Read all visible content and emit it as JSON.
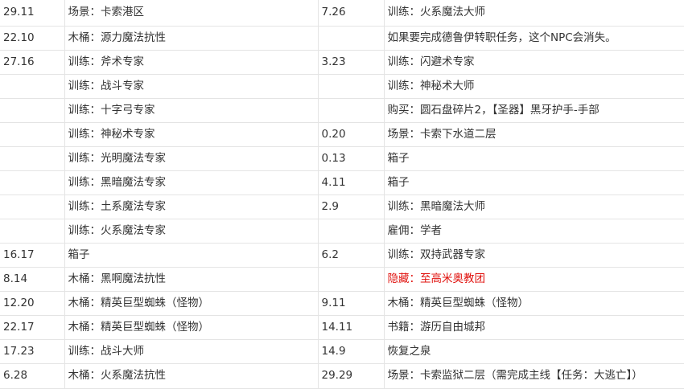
{
  "colors": {
    "text": "#333333",
    "highlight_red": "#e0120e",
    "grid_line": "#e4e4e4"
  },
  "rows": [
    {
      "c1": "29.11",
      "c2": "场景：卡索港区",
      "c3": "7.26",
      "c4": "训练：火系魔法大师"
    },
    {
      "c1": "22.10",
      "c2": "木桶：源力魔法抗性",
      "c3": "",
      "c4": "如果要完成德鲁伊转职任务，这个NPC会消失。"
    },
    {
      "c1": "27.16",
      "c2": "训练：斧术专家",
      "c3": "3.23",
      "c4": "训练：闪避术专家"
    },
    {
      "c1": "",
      "c2": "训练：战斗专家",
      "c3": "",
      "c4": "训练：神秘术大师"
    },
    {
      "c1": "",
      "c2": "训练：十字弓专家",
      "c3": "",
      "c4": "购买：圆石盘碎片2，【圣器】黑牙护手-手部"
    },
    {
      "c1": "",
      "c2": "训练：神秘术专家",
      "c3": "0.20",
      "c4": "场景：卡索下水道二层"
    },
    {
      "c1": "",
      "c2": "训练：光明魔法专家",
      "c3": "0.13",
      "c4": "箱子"
    },
    {
      "c1": "",
      "c2": "训练：黑暗魔法专家",
      "c3": "4.11",
      "c4": "箱子"
    },
    {
      "c1": "",
      "c2": "训练：土系魔法专家",
      "c3": "2.9",
      "c4": "训练：黑暗魔法大师"
    },
    {
      "c1": "",
      "c2": "训练：火系魔法专家",
      "c3": "",
      "c4": "雇佣：学者"
    },
    {
      "c1": "16.17",
      "c2": "箱子",
      "c3": "6.2",
      "c4": "训练：双持武器专家"
    },
    {
      "c1": "8.14",
      "c2": "木桶：黑啊魔法抗性",
      "c3": "",
      "c4": "隐藏：至高米奥教团",
      "c4_red": true
    },
    {
      "c1": "12.20",
      "c2": "木桶：精英巨型蜘蛛（怪物）",
      "c3": "9.11",
      "c4": "木桶：精英巨型蜘蛛（怪物）"
    },
    {
      "c1": "22.17",
      "c2": "木桶：精英巨型蜘蛛（怪物）",
      "c3": "14.11",
      "c4": "书籍：游历自由城邦"
    },
    {
      "c1": "17.23",
      "c2": "训练：战斗大师",
      "c3": "14.9",
      "c4": "恢复之泉"
    },
    {
      "c1": "6.28",
      "c2": "木桶：火系魔法抗性",
      "c3": "29.29",
      "c4": "场景：卡索监狱二层（需完成主线【任务：大逃亡】）"
    }
  ]
}
